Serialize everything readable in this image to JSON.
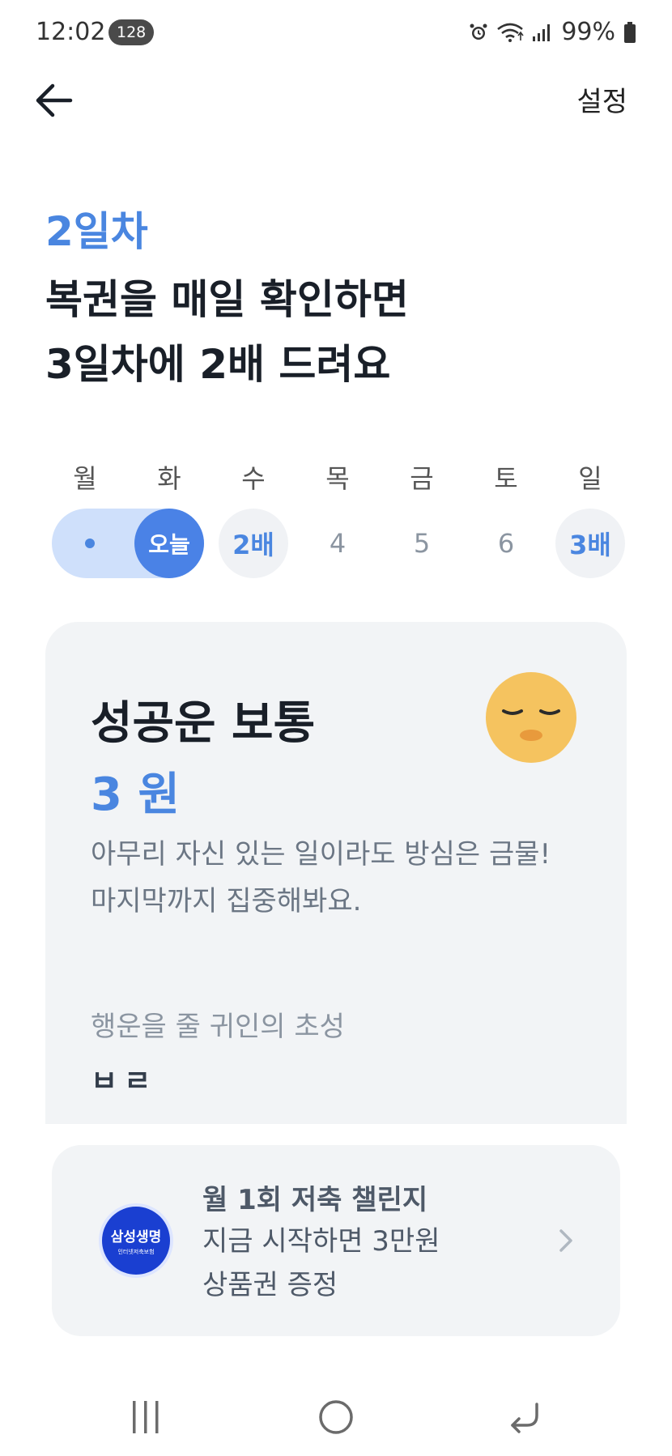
{
  "status_bar": {
    "time": "12:02",
    "badge": "128",
    "battery": "99%"
  },
  "header": {
    "back_icon": "arrow-left-icon",
    "settings_label": "설정"
  },
  "hero": {
    "day_label": "2일차",
    "headline_line1": "복권을 매일 확인하면",
    "headline_line2": "3일차에 2배 드려요"
  },
  "week": {
    "weekdays": [
      "월",
      "화",
      "수",
      "목",
      "금",
      "토",
      "일"
    ],
    "today_label": "오늘",
    "days": [
      "2배",
      "4",
      "5",
      "6",
      "3배"
    ],
    "accent_color": "#4a86e0"
  },
  "fortune_card": {
    "title": "성공운 보통",
    "amount": "3 원",
    "desc_line1": "아무리 자신 있는 일이라도 방심은 금물!",
    "desc_line2": "마지막까지 집중해봐요.",
    "hint_label": "행운을 줄 귀인의 초성",
    "hint_value": "ㅂㄹ",
    "emoji": "relieved-face-icon"
  },
  "ad": {
    "logo_main": "삼성생명",
    "logo_sub": "인터넷저축보험",
    "title": "월 1회 저축 챌린지",
    "body_line1": "지금 시작하면 3만원",
    "body_line2": "상품권 증정"
  }
}
